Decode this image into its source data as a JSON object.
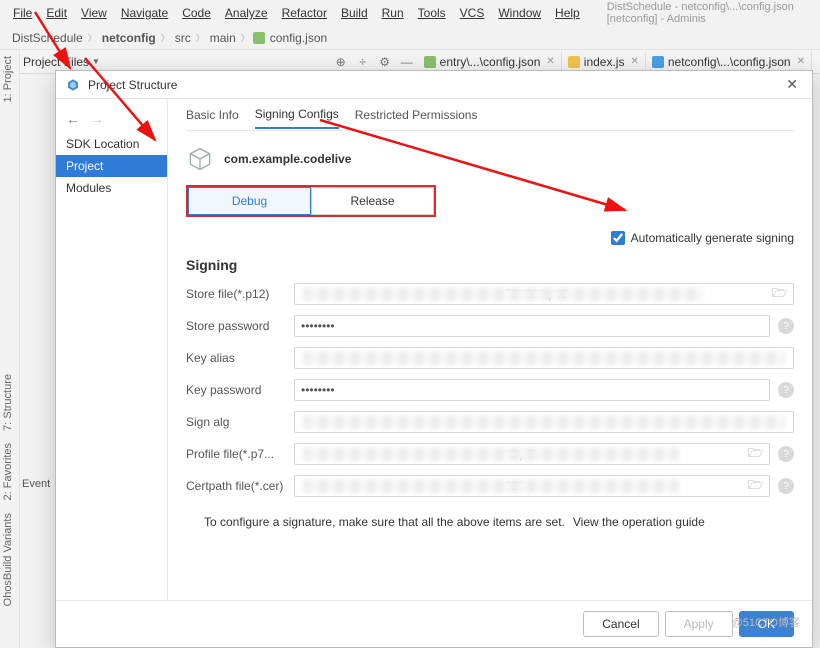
{
  "menubar": {
    "items": [
      "File",
      "Edit",
      "View",
      "Navigate",
      "Code",
      "Analyze",
      "Refactor",
      "Build",
      "Run",
      "Tools",
      "VCS",
      "Window",
      "Help"
    ],
    "window_title": "DistSchedule - netconfig\\...\\config.json [netconfig] - Adminis"
  },
  "breadcrumb": {
    "items": [
      "DistSchedule",
      "netconfig",
      "src",
      "main",
      "config.json"
    ],
    "bold_index": 1
  },
  "tabbar": {
    "project_label": "Project Files",
    "files": [
      {
        "icon": "json",
        "name": "entry\\...\\config.json"
      },
      {
        "icon": "js",
        "name": "index.js"
      },
      {
        "icon": "nc",
        "name": "netconfig\\...\\config.json"
      }
    ]
  },
  "sidestrip": {
    "project": "1: Project",
    "structure": "7: Structure",
    "favorites": "2: Favorites",
    "variants": "OhosBuild Variants",
    "events": "Event"
  },
  "dialog": {
    "title": "Project Structure",
    "nav": {
      "back_forward": true,
      "items": [
        "SDK Location",
        "Project",
        "Modules"
      ],
      "selected_index": 1
    },
    "tabs": {
      "items": [
        "Basic Info",
        "Signing Configs",
        "Restricted Permissions"
      ],
      "selected_index": 1
    },
    "app_name": "com.example.codelive",
    "build_tabs": {
      "debug": "Debug",
      "release": "Release",
      "selected": "Debug"
    },
    "auto_sign": {
      "label": "Automatically generate signing",
      "checked": true
    },
    "signing": {
      "title": "Signing",
      "store_file": {
        "label": "Store file(*.p12)",
        "suffix": "781323.p12"
      },
      "store_password": {
        "label": "Store password",
        "value": "••••••••"
      },
      "key_alias": {
        "label": "Key alias",
        "value": ""
      },
      "key_password": {
        "label": "Key password",
        "value": "••••••••"
      },
      "sign_alg": {
        "label": "Sign alg",
        "value": ""
      },
      "profile_file": {
        "label": "Profile file(*.p7...",
        "suffix": "3.p7b"
      },
      "certpath_file": {
        "label": "Certpath file(*.cer)",
        "suffix": "323.cer"
      }
    },
    "footer": {
      "hint": "To configure a signature, make sure that all the above items are set.",
      "link": "View the operation guide",
      "cancel": "Cancel",
      "apply": "Apply",
      "ok": "OK"
    }
  },
  "watermark": "@51CTO博客"
}
